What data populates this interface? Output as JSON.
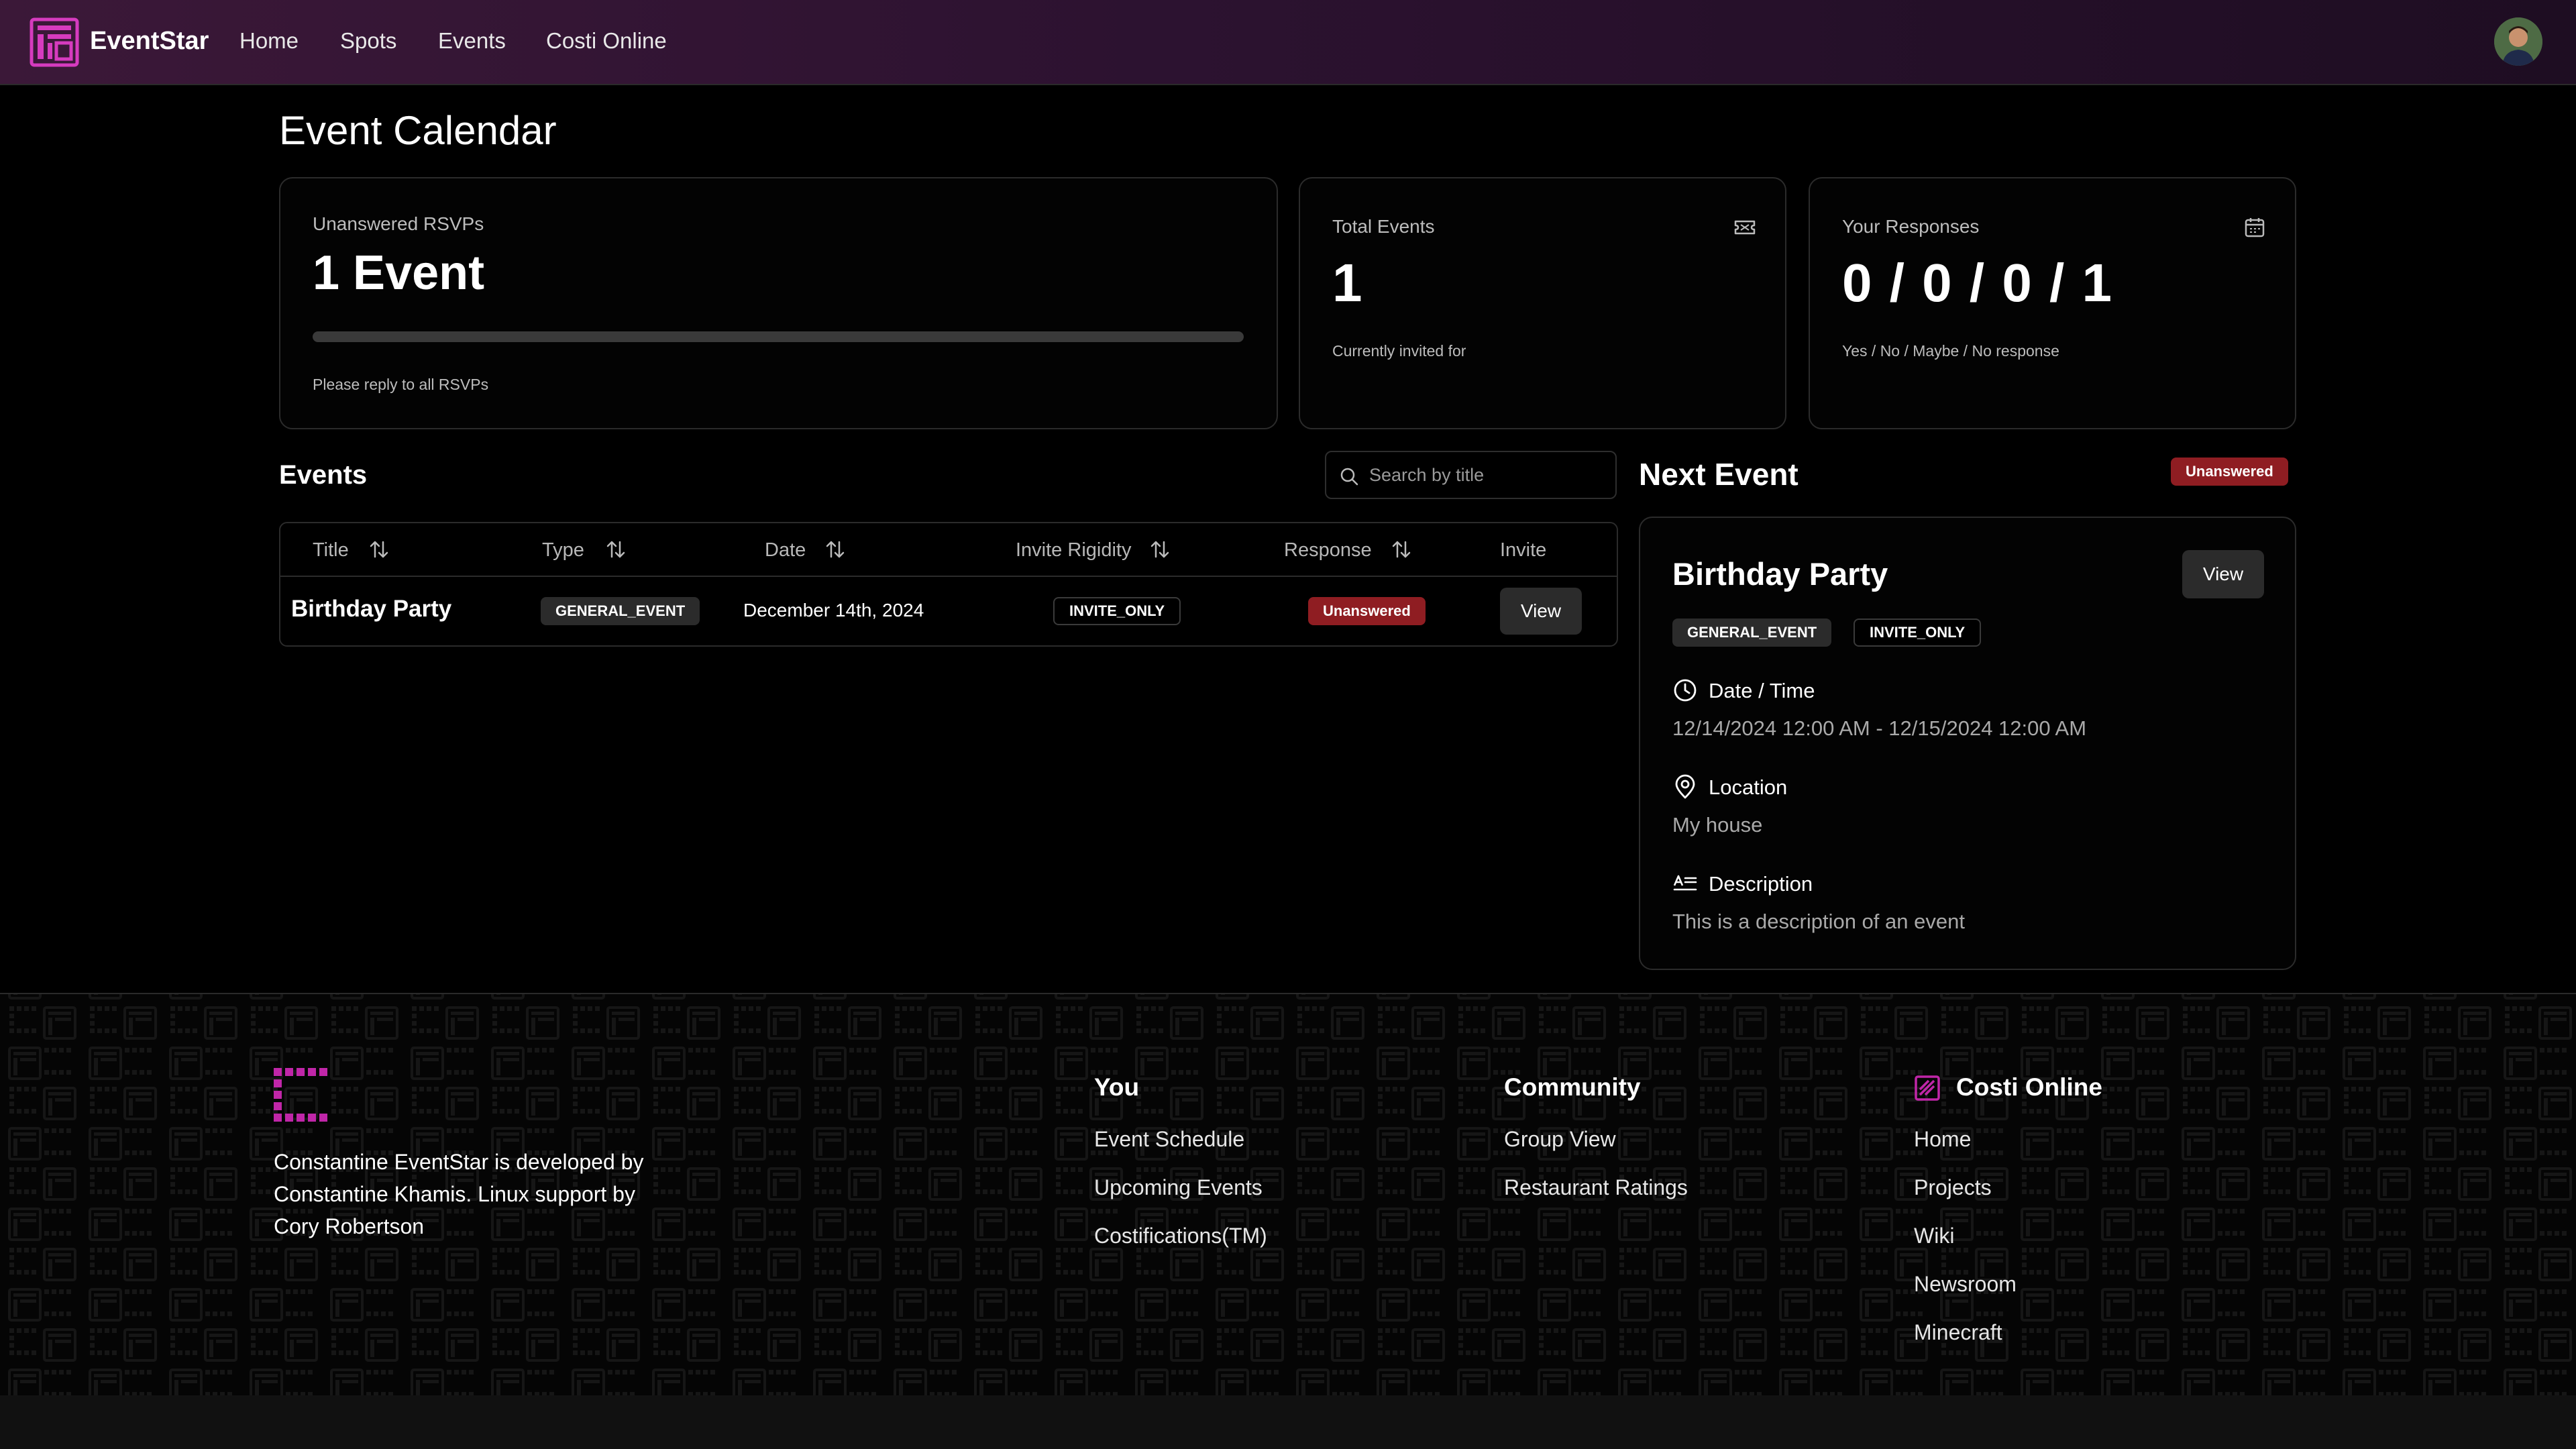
{
  "header": {
    "brand": "EventStar",
    "nav": [
      "Home",
      "Spots",
      "Events",
      "Costi Online"
    ]
  },
  "page_title": "Event Calendar",
  "stats": {
    "unanswered": {
      "label": "Unanswered RSVPs",
      "value": "1 Event",
      "note": "Please reply to all RSVPs",
      "progress": 0
    },
    "total": {
      "label": "Total Events",
      "value": "1",
      "note": "Currently invited for",
      "icon": "ticket-icon"
    },
    "responses": {
      "label": "Your Responses",
      "value": "0 / 0 / 0 / 1",
      "note": "Yes / No / Maybe / No response",
      "icon": "calendar-icon"
    }
  },
  "events": {
    "title": "Events",
    "search_placeholder": "Search by title",
    "columns": [
      "Title",
      "Type",
      "Date",
      "Invite Rigidity",
      "Response",
      "Invite"
    ],
    "rows": [
      {
        "title": "Birthday Party",
        "type": "GENERAL_EVENT",
        "date": "December 14th, 2024",
        "rigidity": "INVITE_ONLY",
        "response": "Unanswered",
        "action": "View"
      }
    ]
  },
  "next_event": {
    "heading": "Next Event",
    "status": "Unanswered",
    "title": "Birthday Party",
    "view_label": "View",
    "tags": [
      "GENERAL_EVENT",
      "INVITE_ONLY"
    ],
    "datetime_label": "Date / Time",
    "datetime_value": "12/14/2024 12:00 AM - 12/15/2024 12:00 AM",
    "location_label": "Location",
    "location_value": "My house",
    "description_label": "Description",
    "description_value": "This is a description of an event"
  },
  "footer": {
    "about": "Constantine EventStar is developed by Constantine Khamis. Linux support by Cory Robertson",
    "columns": [
      {
        "heading": "You",
        "links": [
          "Event Schedule",
          "Upcoming Events",
          "Costifications(TM)"
        ]
      },
      {
        "heading": "Community",
        "links": [
          "Group View",
          "Restaurant Ratings"
        ]
      },
      {
        "heading": "Costi Online",
        "links": [
          "Home",
          "Projects",
          "Wiki",
          "Newsroom",
          "Minecraft"
        ]
      }
    ]
  },
  "colors": {
    "accent": "#c026a8",
    "badge_red": "#8f1d22",
    "header_bg": "#3b1838"
  }
}
